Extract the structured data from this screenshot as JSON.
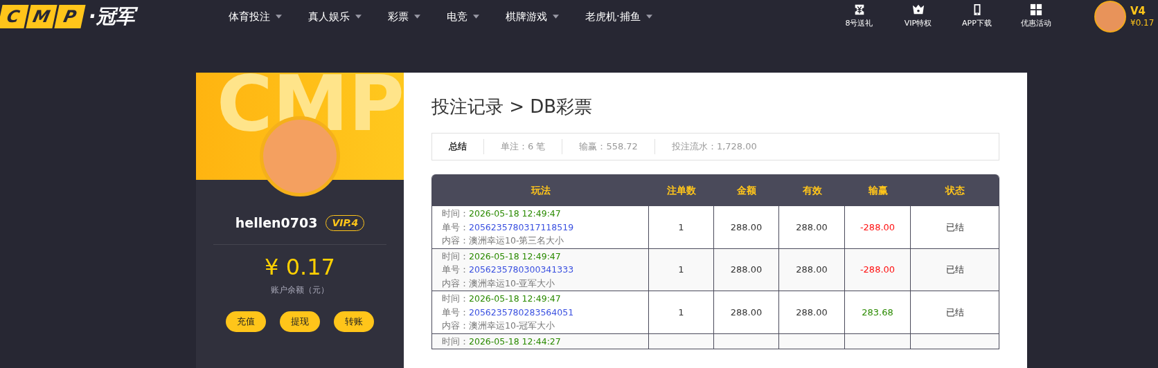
{
  "header": {
    "logo_letters": [
      "C",
      "M",
      "P"
    ],
    "logo_text": "·冠军",
    "nav": [
      {
        "label": "体育投注"
      },
      {
        "label": "真人娱乐"
      },
      {
        "label": "彩票"
      },
      {
        "label": "电竞"
      },
      {
        "label": "棋牌游戏"
      },
      {
        "label": "老虎机·捕鱼"
      }
    ],
    "shortcuts": [
      {
        "kind": "ticket",
        "label": "8号送礼"
      },
      {
        "kind": "crown",
        "label": "VIP特权"
      },
      {
        "kind": "phone",
        "label": "APP下载"
      },
      {
        "kind": "grid",
        "label": "优惠活动"
      }
    ],
    "user": {
      "level": "V4",
      "balance": "¥0.17"
    }
  },
  "profile": {
    "banner_text": "CMP",
    "username": "hellen0703",
    "vip": "VIP.4",
    "balance": "¥ 0.17",
    "balance_label": "账户余额（元）",
    "buttons": [
      "充值",
      "提现",
      "转账"
    ]
  },
  "page": {
    "title": "投注记录 > DB彩票",
    "summary": [
      {
        "label": "总结",
        "bold": true
      },
      {
        "label": "单注：6 笔",
        "bold": false
      },
      {
        "label": "输赢：558.72",
        "bold": false
      },
      {
        "label": "投注流水：1,728.00",
        "bold": false
      }
    ],
    "table": {
      "columns": [
        "玩法",
        "注单数",
        "金额",
        "有效",
        "输赢",
        "状态"
      ],
      "rows": [
        {
          "time_label": "时间：",
          "time": "2026-05-18 12:49:47",
          "no_label": "单号：",
          "no": "2056235780317118519",
          "content_label": "内容：",
          "content": "澳洲幸运10-第三名大小",
          "count": "1",
          "amount": "288.00",
          "valid": "288.00",
          "result": "-288.00",
          "win": false,
          "status": "已结"
        },
        {
          "time_label": "时间：",
          "time": "2026-05-18 12:49:47",
          "no_label": "单号：",
          "no": "2056235780300341333",
          "content_label": "内容：",
          "content": "澳洲幸运10-亚军大小",
          "count": "1",
          "amount": "288.00",
          "valid": "288.00",
          "result": "-288.00",
          "win": false,
          "status": "已结"
        },
        {
          "time_label": "时间：",
          "time": "2026-05-18 12:49:47",
          "no_label": "单号：",
          "no": "2056235780283564051",
          "content_label": "内容：",
          "content": "澳洲幸运10-冠军大小",
          "count": "1",
          "amount": "288.00",
          "valid": "288.00",
          "result": "283.68",
          "win": true,
          "status": "已结"
        },
        {
          "time_label": "时间：",
          "time": "2026-05-18 12:44:27"
        }
      ]
    }
  }
}
